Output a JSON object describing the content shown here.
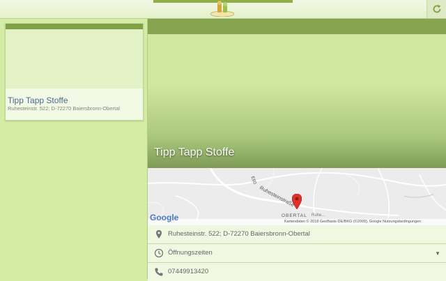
{
  "header": {
    "logo_alt": "logo",
    "refresh_icon": "refresh-icon"
  },
  "sidebar": {
    "cards": [
      {
        "title": "Tipp Tapp Stoffe",
        "address": "Ruhesteinstr. 522; D-72270 Baiersbronn-Obertal"
      }
    ]
  },
  "detail": {
    "title": "Tipp Tapp Stoffe",
    "map": {
      "street_label": "Ruhesteinstraße",
      "road_number": "E60",
      "town_label": "OBERTAL",
      "partial_label": "Ruhe...",
      "google_label": "Google",
      "credit": "Kartendaten © 2018 GeoBasis-DE/BKG (©2009), Google   Nutzungsbedingungen"
    },
    "rows": {
      "address": "Ruhesteinstr. 522; D-72270 Baiersbronn-Obertal",
      "hours": "Öffnungszeiten",
      "phone": "07449913420"
    }
  },
  "colors": {
    "accent": "#87a44e",
    "panel": "#d4eca4",
    "pin": "#e0302a"
  }
}
